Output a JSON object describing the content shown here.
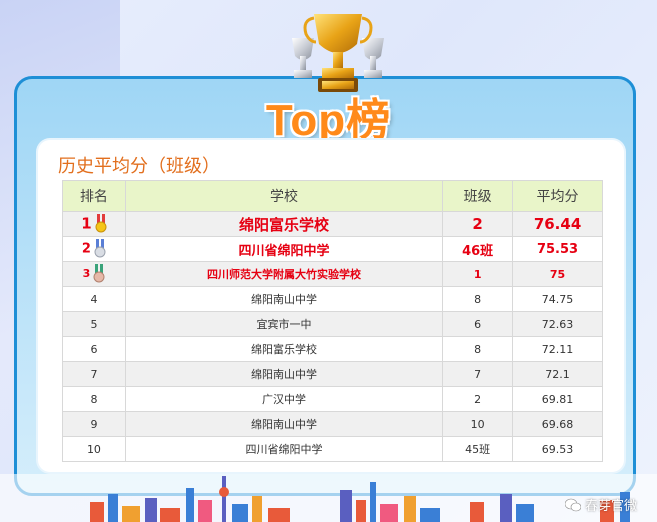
{
  "header": {
    "title": "Top榜"
  },
  "panel": {
    "title": "历史平均分（班级）"
  },
  "table": {
    "columns": [
      "排名",
      "学校",
      "班级",
      "平均分"
    ],
    "rows": [
      {
        "rank": "1",
        "school": "绵阳富乐学校",
        "class": "2",
        "score": "76.44"
      },
      {
        "rank": "2",
        "school": "四川省绵阳中学",
        "class": "46班",
        "score": "75.53"
      },
      {
        "rank": "3",
        "school": "四川师范大学附属大竹实验学校",
        "class": "1",
        "score": "75"
      },
      {
        "rank": "4",
        "school": "绵阳南山中学",
        "class": "8",
        "score": "74.75"
      },
      {
        "rank": "5",
        "school": "宜宾市一中",
        "class": "6",
        "score": "72.63"
      },
      {
        "rank": "6",
        "school": "绵阳富乐学校",
        "class": "8",
        "score": "72.11"
      },
      {
        "rank": "7",
        "school": "绵阳南山中学",
        "class": "7",
        "score": "72.1"
      },
      {
        "rank": "8",
        "school": "广汉中学",
        "class": "2",
        "score": "69.81"
      },
      {
        "rank": "9",
        "school": "绵阳南山中学",
        "class": "10",
        "score": "69.68"
      },
      {
        "rank": "10",
        "school": "四川省绵阳中学",
        "class": "45班",
        "score": "69.53"
      }
    ]
  },
  "watermark": {
    "text": "春芽官微"
  },
  "colors": {
    "accent": "#ff8a1a",
    "border": "#1e8fd6",
    "highlight": "#e60012",
    "header_bg": "#e9f5c9"
  },
  "icons": {
    "trophy": "trophy-icon",
    "gold": "gold-medal-icon",
    "silver": "silver-medal-icon",
    "bronze": "bronze-medal-icon",
    "wechat": "wechat-icon"
  }
}
